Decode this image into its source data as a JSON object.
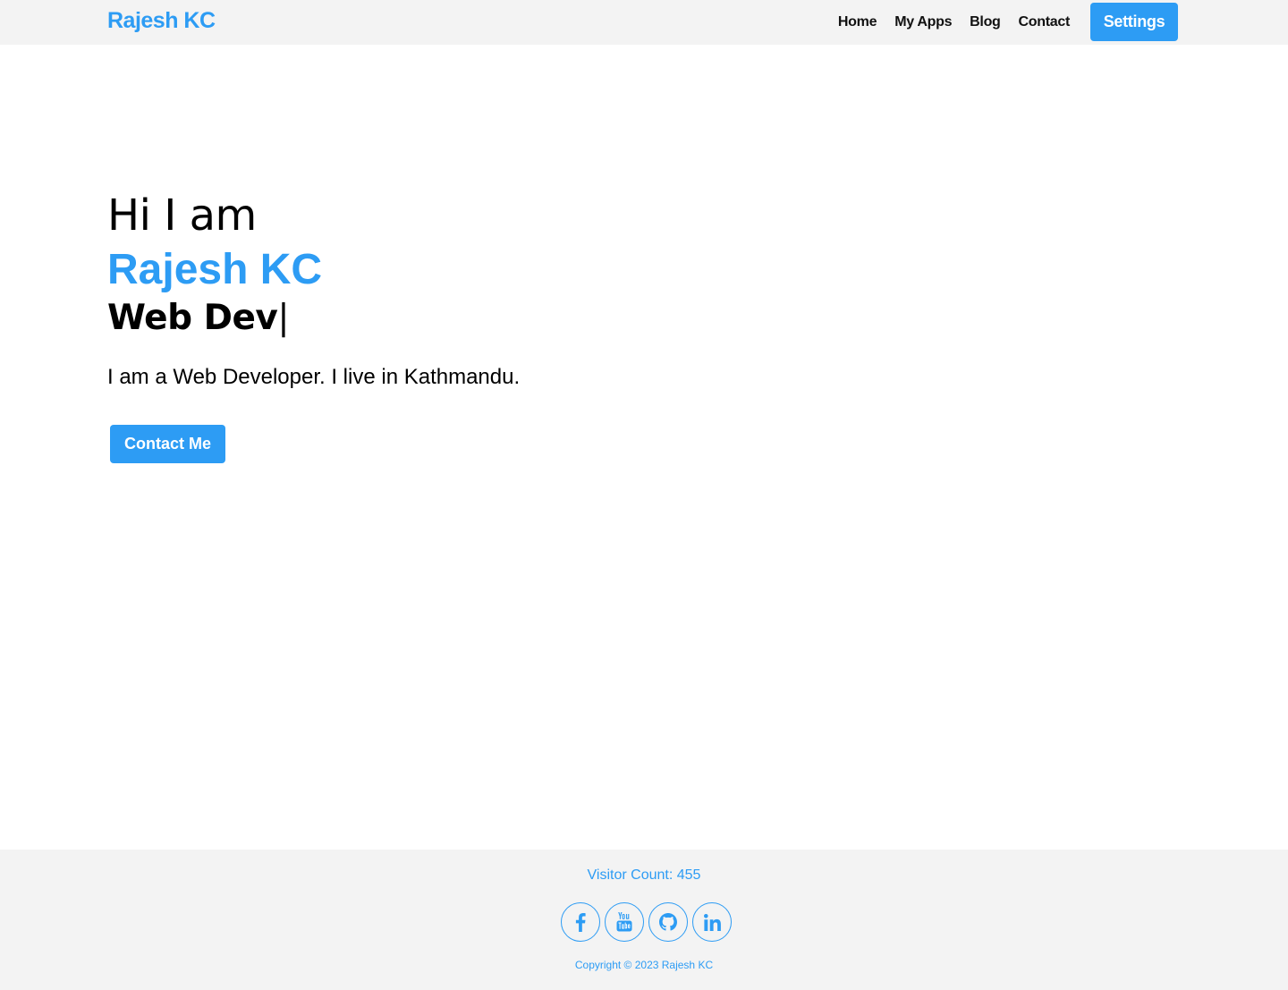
{
  "colors": {
    "accent": "#2d9cf4",
    "navbar_bg": "#f3f3f3",
    "footer_bg": "#f3f3f3",
    "text": "#000000"
  },
  "navbar": {
    "brand": "Rajesh KC",
    "links": [
      {
        "label": "Home"
      },
      {
        "label": "My Apps"
      },
      {
        "label": "Blog"
      },
      {
        "label": "Contact"
      }
    ],
    "settings_label": "Settings"
  },
  "hero": {
    "greeting": "Hi I am",
    "name": "Rajesh KC",
    "role": "Web Dev",
    "cursor": "|",
    "description": "I am a Web Developer. I live in Kathmandu.",
    "contact_label": "Contact Me"
  },
  "footer": {
    "visitor_count": "Visitor Count: 455",
    "socials": [
      {
        "icon": "facebook-icon"
      },
      {
        "icon": "youtube-icon"
      },
      {
        "icon": "github-icon"
      },
      {
        "icon": "linkedin-icon"
      }
    ],
    "copyright": "Copyright © 2023 Rajesh KC"
  }
}
